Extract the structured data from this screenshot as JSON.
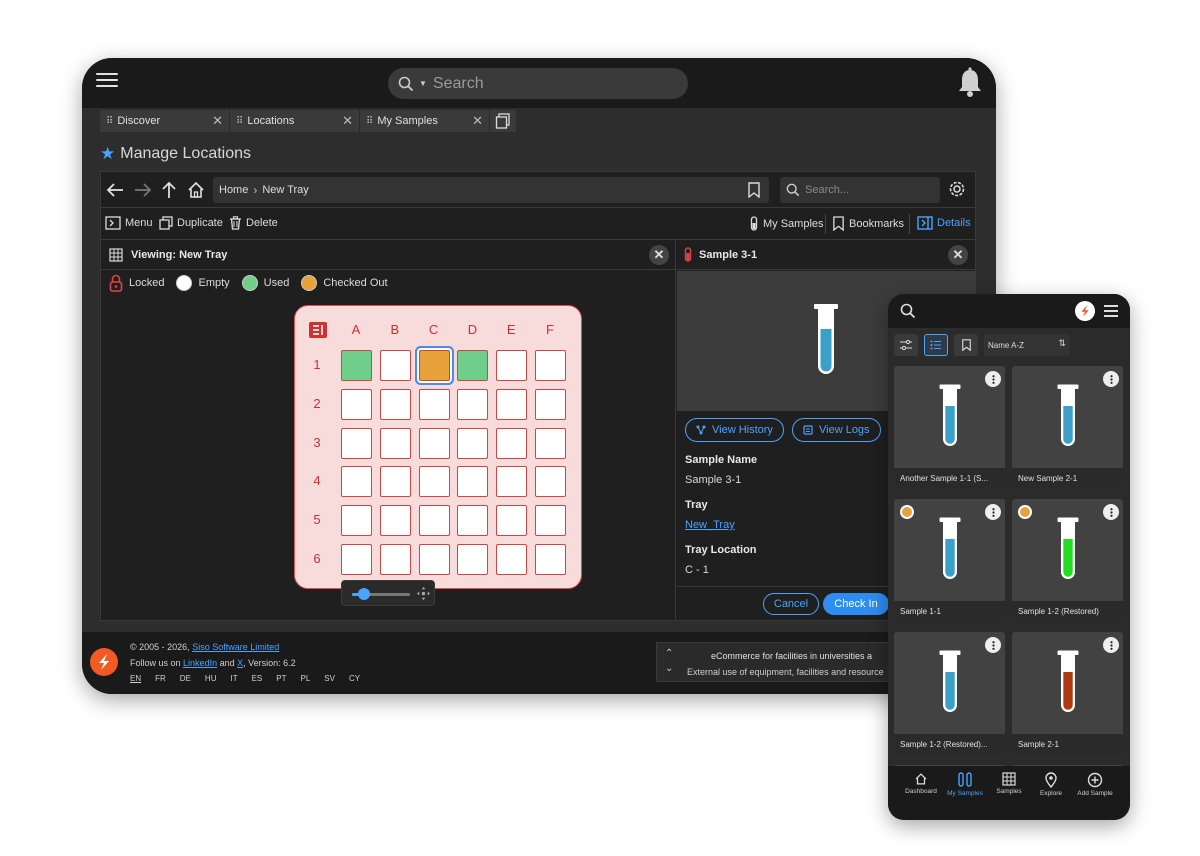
{
  "search": {
    "placeholder": "Search"
  },
  "tabs": [
    {
      "label": "Discover"
    },
    {
      "label": "Locations"
    },
    {
      "label": "My Samples"
    }
  ],
  "page_title": "Manage Locations",
  "breadcrumb": {
    "home": "Home",
    "current": "New Tray"
  },
  "search_box": {
    "placeholder": "Search..."
  },
  "toolbar": {
    "menu": "Menu",
    "duplicate": "Duplicate",
    "delete": "Delete",
    "my_samples": "My Samples",
    "bookmarks": "Bookmarks",
    "details": "Details"
  },
  "viewer": {
    "title": "Viewing: New Tray",
    "legend": {
      "locked": "Locked",
      "empty": "Empty",
      "used": "Used",
      "checked_out": "Checked Out"
    },
    "columns": [
      "A",
      "B",
      "C",
      "D",
      "E",
      "F"
    ],
    "rows": [
      "1",
      "2",
      "3",
      "4",
      "5",
      "6"
    ],
    "zoom": 0.2
  },
  "detail": {
    "title": "Sample 3-1",
    "view_history": "View History",
    "view_logs": "View Logs",
    "sample_name_label": "Sample Name",
    "sample_name": "Sample 3-1",
    "tray_label": "Tray",
    "tray_value": "New_Tray",
    "tray_location_label": "Tray Location",
    "tray_location": "C - 1",
    "cancel": "Cancel",
    "check_in": "Check In"
  },
  "footer": {
    "copyright": "© 2005 - 2026,",
    "company": "Siso Software Limited",
    "follow": "Follow us on",
    "linkedin": "LinkedIn",
    "and": "and",
    "x": "X",
    "version": ", Version: 6.2",
    "languages": [
      "EN",
      "FR",
      "DE",
      "HU",
      "IT",
      "ES",
      "PT",
      "PL",
      "SV",
      "CY"
    ],
    "promo_title": "eCommerce for facilities in universities a",
    "promo_text": "External use of equipment, facilities and resource"
  },
  "phone": {
    "sort": "Name A-Z",
    "cards": [
      {
        "label": "Another Sample 1-1 (S...",
        "liquid": "#3aa0c8",
        "status": false
      },
      {
        "label": "New Sample 2-1",
        "liquid": "#3aa0c8",
        "status": false
      },
      {
        "label": "Sample 1-1",
        "liquid": "#3aa0c8",
        "status": true
      },
      {
        "label": "Sample 1-2 (Restored)",
        "liquid": "#22dd22",
        "status": true
      },
      {
        "label": "Sample 1-2 (Restored)...",
        "liquid": "#3aa0c8",
        "status": false
      },
      {
        "label": "Sample 2-1",
        "liquid": "#b03a10",
        "status": false
      }
    ],
    "nav": [
      "Dashboard",
      "My Samples",
      "Samples",
      "Explore",
      "Add Sample"
    ]
  },
  "colors": {
    "accent": "#4aa3ff",
    "used": "#6fcf8a",
    "checked_out": "#e8a23c",
    "tray_border": "#d04444",
    "brand": "#f15a24"
  }
}
